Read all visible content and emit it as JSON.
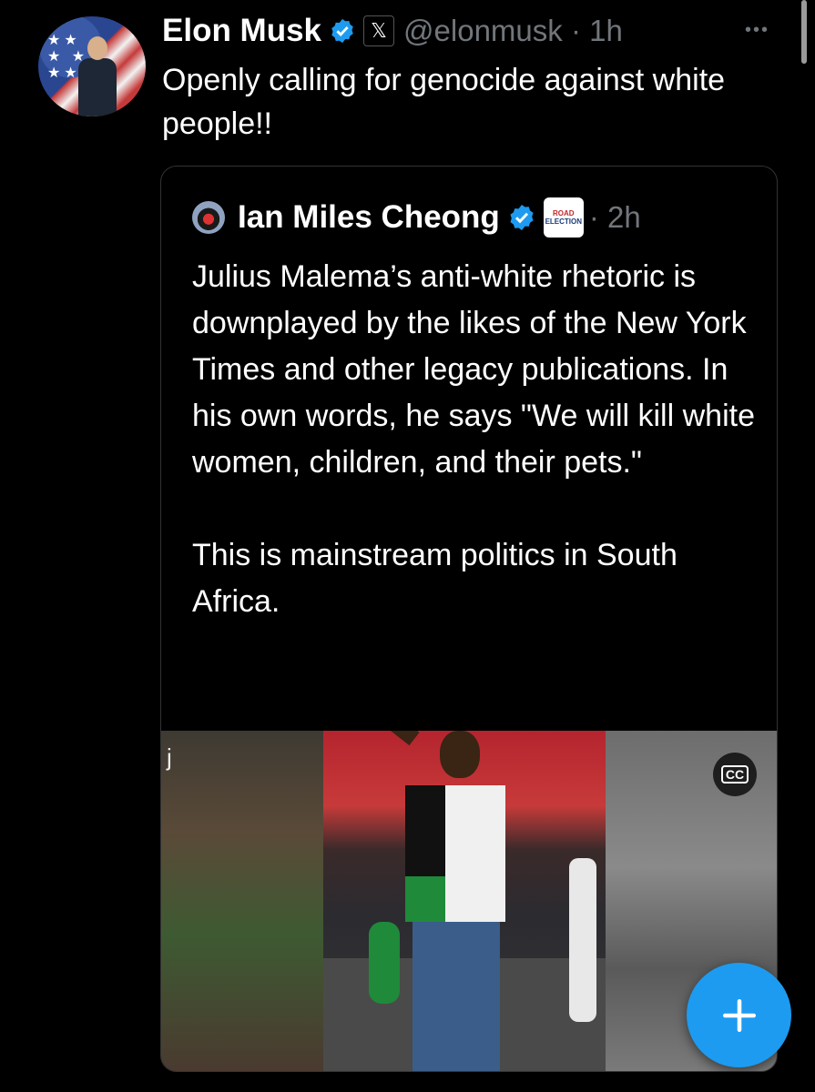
{
  "tweet": {
    "author_name": "Elon Musk",
    "handle": "@elonmusk",
    "time": "· 1h",
    "x_badge_glyph": "𝕏",
    "text": "Openly calling for genocide against white people!!",
    "more_glyph": "•••"
  },
  "quote": {
    "author_name": "Ian Miles Cheong",
    "badge_line1": "ROAD",
    "badge_line2": "ELECTION",
    "time": "· 2h",
    "text": "Julius Malema’s anti-white rhetoric  is downplayed by the likes of the New York Times and other legacy publications. In his own words, he says \"We will kill white women, children, and their pets.\"\n\nThis is mainstream politics in South Africa.",
    "media_left_glyph": "j",
    "captions_label": "CC"
  },
  "fab": {
    "icon": "plus-icon"
  },
  "colors": {
    "accent": "#1d9bf0",
    "background": "#000000",
    "muted": "#71767b"
  }
}
